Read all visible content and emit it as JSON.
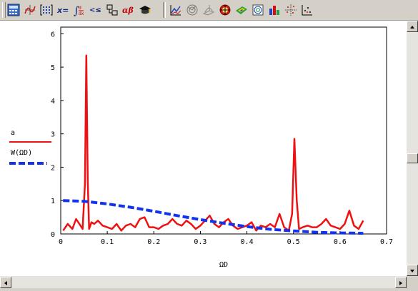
{
  "toolbar": {
    "buttons": [
      {
        "id": "calculator",
        "icon": "calculator-icon"
      },
      {
        "id": "graph",
        "icon": "graph-toolbar-icon"
      },
      {
        "id": "matrix",
        "icon": "matrix-toolbar-icon"
      },
      {
        "id": "evaluation",
        "icon": "evaluation-icon",
        "label": "x="
      },
      {
        "id": "calculus",
        "icon": "calculus-icon"
      },
      {
        "id": "boolean",
        "icon": "boolean-icon",
        "label": "<≤"
      },
      {
        "id": "programming",
        "icon": "programming-icon"
      },
      {
        "id": "greek",
        "icon": "greek-icon",
        "label": "αβ"
      },
      {
        "id": "symbolic",
        "icon": "symbolic-icon"
      },
      {
        "id": "xy-plot",
        "icon": "xy-plot-icon"
      },
      {
        "id": "polar-plot",
        "icon": "polar-plot-icon"
      },
      {
        "id": "surface-plot",
        "icon": "surface-plot-icon"
      },
      {
        "id": "target-plot",
        "icon": "target-icon"
      },
      {
        "id": "contour-plot",
        "icon": "contour-icon"
      },
      {
        "id": "3d-scatter",
        "icon": "scatter-3d-icon"
      },
      {
        "id": "3d-bar",
        "icon": "bar-3d-icon"
      },
      {
        "id": "vector-field",
        "icon": "vector-field-icon"
      },
      {
        "id": "zoom",
        "icon": "zoom-icon"
      }
    ]
  },
  "chart_data": {
    "type": "line",
    "xlabel": "ΩD",
    "ylabel": "",
    "xlim": [
      0,
      0.7
    ],
    "ylim": [
      0,
      6.2
    ],
    "xticks": [
      "0",
      "0.1",
      "0.2",
      "0.3",
      "0.4",
      "0.5",
      "0.6",
      "0.7"
    ],
    "yticks": [
      "0",
      "1",
      "2",
      "3",
      "4",
      "5",
      "6"
    ],
    "grid": false,
    "legend_position": "left",
    "series": [
      {
        "name": "a",
        "color": "#ee1111",
        "style": "solid",
        "x": [
          0.005,
          0.015,
          0.025,
          0.033,
          0.04,
          0.047,
          0.052,
          0.055,
          0.058,
          0.061,
          0.066,
          0.072,
          0.08,
          0.09,
          0.1,
          0.11,
          0.12,
          0.13,
          0.14,
          0.15,
          0.16,
          0.17,
          0.18,
          0.19,
          0.2,
          0.21,
          0.22,
          0.23,
          0.24,
          0.25,
          0.26,
          0.27,
          0.28,
          0.29,
          0.3,
          0.31,
          0.32,
          0.33,
          0.34,
          0.35,
          0.36,
          0.37,
          0.38,
          0.39,
          0.4,
          0.41,
          0.42,
          0.43,
          0.44,
          0.45,
          0.46,
          0.47,
          0.48,
          0.49,
          0.497,
          0.502,
          0.507,
          0.512,
          0.52,
          0.53,
          0.54,
          0.55,
          0.56,
          0.57,
          0.58,
          0.59,
          0.6,
          0.61,
          0.62,
          0.63,
          0.64,
          0.65
        ],
        "values": [
          0.1,
          0.3,
          0.15,
          0.45,
          0.3,
          0.15,
          1.5,
          5.35,
          1.6,
          0.15,
          0.35,
          0.3,
          0.4,
          0.25,
          0.2,
          0.15,
          0.3,
          0.1,
          0.25,
          0.3,
          0.2,
          0.45,
          0.5,
          0.2,
          0.2,
          0.15,
          0.25,
          0.3,
          0.45,
          0.3,
          0.25,
          0.4,
          0.3,
          0.15,
          0.25,
          0.4,
          0.55,
          0.3,
          0.2,
          0.35,
          0.45,
          0.25,
          0.15,
          0.2,
          0.25,
          0.35,
          0.1,
          0.25,
          0.2,
          0.3,
          0.2,
          0.6,
          0.2,
          0.1,
          0.6,
          2.85,
          1.0,
          0.15,
          0.2,
          0.25,
          0.2,
          0.2,
          0.3,
          0.45,
          0.25,
          0.2,
          0.15,
          0.3,
          0.7,
          0.25,
          0.15,
          0.4
        ]
      },
      {
        "name": "W(ΩD)",
        "color": "#1133ee",
        "style": "dashed",
        "x": [
          0.005,
          0.05,
          0.1,
          0.15,
          0.2,
          0.25,
          0.3,
          0.35,
          0.4,
          0.45,
          0.5,
          0.55,
          0.6,
          0.65
        ],
        "values": [
          1.0,
          0.98,
          0.9,
          0.8,
          0.68,
          0.55,
          0.43,
          0.32,
          0.22,
          0.14,
          0.09,
          0.05,
          0.03,
          0.02
        ]
      }
    ]
  }
}
